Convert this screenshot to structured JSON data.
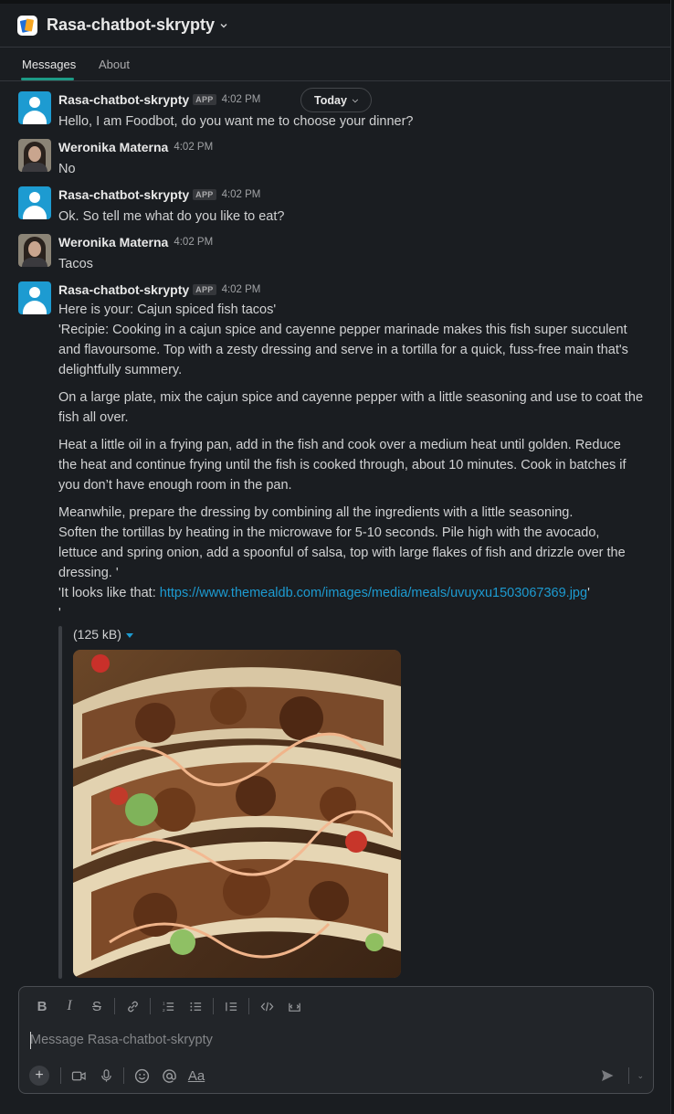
{
  "header": {
    "channel_title": "Rasa-chatbot-skrypty"
  },
  "tabs": [
    {
      "label": "Messages",
      "active": true
    },
    {
      "label": "About",
      "active": false
    }
  ],
  "date_divider": {
    "label": "Today"
  },
  "messages": [
    {
      "author": "Rasa-chatbot-skrypty",
      "badge": "APP",
      "time": "4:02 PM",
      "text": "Hello, I am Foodbot, do you want me to choose your dinner?"
    },
    {
      "author": "Weronika Materna",
      "time": "4:02 PM",
      "text": "No"
    },
    {
      "author": "Rasa-chatbot-skrypty",
      "badge": "APP",
      "time": "4:02 PM",
      "text": "Ok. So tell me what do you like to eat?"
    },
    {
      "author": "Weronika Materna",
      "time": "4:02 PM",
      "text": "Tacos"
    },
    {
      "author": "Rasa-chatbot-skrypty",
      "badge": "APP",
      "time": "4:02 PM",
      "lines": [
        "Here is your: Cajun spiced fish tacos'",
        "'Recipie:  Cooking in a cajun spice and cayenne pepper marinade makes this fish super succulent",
        "and flavoursome. Top with a zesty dressing and serve in a tortilla for a quick, fuss-free main that's",
        "delightfully summery.",
        "On a large plate, mix the cajun spice and cayenne pepper with a little seasoning and use to coat the",
        "fish all over.",
        "Heat a little oil in a frying pan, add in the fish and cook over a medium heat until golden. Reduce",
        "the heat and continue frying until the fish is cooked through, about 10 minutes. Cook in batches if",
        "you don’t have enough room in the pan.",
        "Meanwhile, prepare the dressing by combining all the ingredients with a little seasoning.",
        "Soften the tortillas by heating in the microwave for 5-10 seconds. Pile high with the avocado,",
        "lettuce and spring onion, add a spoonful of salsa, top with large flakes of fish and drizzle over the",
        "dressing. '"
      ],
      "link_prefix": "'It looks like that:  ",
      "link_url": "https://www.themealdb.com/images/media/meals/uvuyxu1503067369.jpg",
      "link_suffix": "'",
      "trailing": "'",
      "attachment": {
        "size_label": "(125 kB)",
        "icon": "caret-down-icon"
      }
    }
  ],
  "composer": {
    "placeholder": "Message Rasa-chatbot-skrypty",
    "format_tools": [
      "bold",
      "italic",
      "strikethrough",
      "link",
      "ordered-list",
      "bulleted-list",
      "blockquote",
      "code",
      "code-block"
    ],
    "bottom_tools": [
      "plus",
      "video",
      "microphone",
      "emoji",
      "mention",
      "formatting"
    ],
    "formatting_label": "Aa"
  },
  "colors": {
    "background": "#1a1d21",
    "accent_tab": "#1d9b86",
    "link": "#1d9bd1",
    "bot_avatar": "#1d9bd1"
  }
}
